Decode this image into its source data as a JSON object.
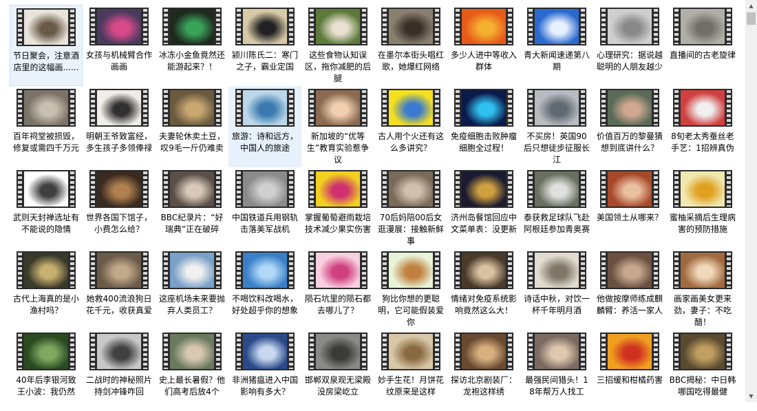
{
  "items": [
    {
      "caption": "节日聚会，注意酒店里的这幅画......",
      "icon": "video-thumbnail-icon",
      "bg": "#e8e4dc",
      "fg": "#6a5a48"
    },
    {
      "caption": "女孩与机械臂合作画画",
      "icon": "video-thumbnail-icon",
      "bg": "#4a3a5e",
      "fg": "#d94a8a"
    },
    {
      "caption": "冰冻小金鱼竟然还能游起来？！",
      "icon": "video-thumbnail-icon",
      "bg": "#1e2a1e",
      "fg": "#3aa35a"
    },
    {
      "caption": "颍川陈氏二：寒门之子，霸业定国",
      "icon": "video-thumbnail-icon",
      "bg": "#d8c9a8",
      "fg": "#222222"
    },
    {
      "caption": "这些食物认知误区，拖你减肥的后腿",
      "icon": "video-thumbnail-icon",
      "bg": "#5c7a3a",
      "fg": "#e8e0d0"
    },
    {
      "caption": "在墨尔本街头唱红歌，她爆红网络",
      "icon": "video-thumbnail-icon",
      "bg": "#8a8070",
      "fg": "#3a3028"
    },
    {
      "caption": "多少人进中等收入群体",
      "icon": "video-thumbnail-icon",
      "bg": "#e85a1a",
      "fg": "#f4b030"
    },
    {
      "caption": "青大新闻速递第八期",
      "icon": "video-thumbnail-icon",
      "bg": "#2a6ad0",
      "fg": "#e8f0ff"
    },
    {
      "caption": "心理研究：据说越聪明的人朋友越少",
      "icon": "video-thumbnail-icon",
      "bg": "#cfcfcf",
      "fg": "#888888"
    },
    {
      "caption": "直播间的古老旋律",
      "icon": "video-thumbnail-icon",
      "bg": "#b0b0a8",
      "fg": "#707068"
    },
    {
      "caption": "百年祠堂被损毁，修复或需四千万元",
      "icon": "video-thumbnail-icon",
      "bg": "#7a7468",
      "fg": "#c8c0b0"
    },
    {
      "caption": "明朝王爷致富经，多生孩子多领俸禄",
      "icon": "video-thumbnail-icon",
      "bg": "#f0eee8",
      "fg": "#303030"
    },
    {
      "caption": "夫妻轮休卖土豆，叹9毛一斤仍难卖",
      "icon": "video-thumbnail-icon",
      "bg": "#6a5a40",
      "fg": "#c8a870"
    },
    {
      "caption": "旅游：诗和远方，中国人的旅途",
      "icon": "video-thumbnail-icon",
      "bg": "#bcd8e8",
      "fg": "#3a7ab0"
    },
    {
      "caption": "新加坡的“优等生”教育实验惹争议",
      "icon": "video-thumbnail-icon",
      "bg": "#8a6a50",
      "fg": "#f0d0b0"
    },
    {
      "caption": "古人用个火还有这么多讲究？",
      "icon": "video-thumbnail-icon",
      "bg": "#f4e020",
      "fg": "#3a7ad0"
    },
    {
      "caption": "免疫细胞击败肿瘤细胞全过程！",
      "icon": "video-thumbnail-icon",
      "bg": "#0a1a4a",
      "fg": "#30c0f0"
    },
    {
      "caption": "不买房！英国90后只想徒步征服长江",
      "icon": "video-thumbnail-icon",
      "bg": "#b8bcc0",
      "fg": "#606870"
    },
    {
      "caption": "价值百万的黎曼猜想到底讲什么？",
      "icon": "video-thumbnail-icon",
      "bg": "#5a6a58",
      "fg": "#d0a890"
    },
    {
      "caption": "8旬老太秀蚕丝老手艺：1招辨真伪",
      "icon": "video-thumbnail-icon",
      "bg": "#d04040",
      "fg": "#f0f0f0"
    },
    {
      "caption": "武则天封禅选址有不能说的隐情",
      "icon": "video-thumbnail-icon",
      "bg": "#ffffff",
      "fg": "#404040"
    },
    {
      "caption": "世界各国下馆子，小费怎么给？",
      "icon": "video-thumbnail-icon",
      "bg": "#3a2a20",
      "fg": "#b08050"
    },
    {
      "caption": "BBC纪录片：“好瑞典”正在破碎",
      "icon": "video-thumbnail-icon",
      "bg": "#5a5048",
      "fg": "#d8c8b8"
    },
    {
      "caption": "中国铁道兵用钢轨击落美军战机",
      "icon": "video-thumbnail-icon",
      "bg": "#8a8a8a",
      "fg": "#d0d0d0"
    },
    {
      "caption": "掌握葡萄避雨栽培技术减少果实伤害",
      "icon": "video-thumbnail-icon",
      "bg": "#f0d020",
      "fg": "#d03070"
    },
    {
      "caption": "70后妈陪00后女逛漫展：接触新鲜事",
      "icon": "video-thumbnail-icon",
      "bg": "#7a6a5a",
      "fg": "#d0c0b0"
    },
    {
      "caption": "济州岛餐馆回应中文菜单表：没更新",
      "icon": "video-thumbnail-icon",
      "bg": "#1a1a30",
      "fg": "#d0a040"
    },
    {
      "caption": "泰获救足球队飞赴阿根廷参加青奥赛",
      "icon": "video-thumbnail-icon",
      "bg": "#6a7060",
      "fg": "#e0e0e0"
    },
    {
      "caption": "美国领土从哪来？",
      "icon": "video-thumbnail-icon",
      "bg": "#a8482a",
      "fg": "#e8c0a0"
    },
    {
      "caption": "蜜柚采摘后生理病害的预防措施",
      "icon": "video-thumbnail-icon",
      "bg": "#f0e8b0",
      "fg": "#e0a020"
    },
    {
      "caption": "古代上海真的是小渔村吗？",
      "icon": "video-thumbnail-icon",
      "bg": "#3a3a2a",
      "fg": "#c8b070"
    },
    {
      "caption": "她救400流浪狗日花千元，收获真爱",
      "icon": "video-thumbnail-icon",
      "bg": "#6a5a48",
      "fg": "#c0a888"
    },
    {
      "caption": "这座机场未来要抛弃人类员工？",
      "icon": "video-thumbnail-icon",
      "bg": "#7aa0c8",
      "fg": "#f0f0f0"
    },
    {
      "caption": "不喝饮料改喝水，好处超乎你的想象",
      "icon": "video-thumbnail-icon",
      "bg": "#3a80c8",
      "fg": "#b0d8f8"
    },
    {
      "caption": "陨石坑里的陨石都去哪儿了？",
      "icon": "video-thumbnail-icon",
      "bg": "#f8d0e0",
      "fg": "#d04080"
    },
    {
      "caption": "狗比你想的更聪明，它可能假装爱你",
      "icon": "video-thumbnail-icon",
      "bg": "#e8f4d8",
      "fg": "#c08040"
    },
    {
      "caption": "情绪对免疫系统影响竟然这么大！",
      "icon": "video-thumbnail-icon",
      "bg": "#4a3a2a",
      "fg": "#d8c0a0"
    },
    {
      "caption": "诗话中秋，对饮一杯千年明月酒",
      "icon": "video-thumbnail-icon",
      "bg": "#e0dcd0",
      "fg": "#807868"
    },
    {
      "caption": "他做按摩师练成麒麟臂：养活一家人",
      "icon": "video-thumbnail-icon",
      "bg": "#6a5040",
      "fg": "#c8a890"
    },
    {
      "caption": "画家画美女更来劲，妻子：不吃醋！",
      "icon": "video-thumbnail-icon",
      "bg": "#a06a40",
      "fg": "#f0d8b8"
    },
    {
      "caption": "40年后李银河致王小波：我仍然",
      "icon": "video-thumbnail-icon",
      "bg": "#2a4a20",
      "fg": "#80a860"
    },
    {
      "caption": "二战时的神秘照片 持剑冲锋咋回",
      "icon": "video-thumbnail-icon",
      "bg": "#c8c8c8",
      "fg": "#404040"
    },
    {
      "caption": "史上最长暑假？他们高考后放4个",
      "icon": "video-thumbnail-icon",
      "bg": "#6a7a60",
      "fg": "#d8c8b0"
    },
    {
      "caption": "非洲猪瘟进入中国影响有多大？",
      "icon": "video-thumbnail-icon",
      "bg": "#2a4a8a",
      "fg": "#c8d8f0"
    },
    {
      "caption": "邯郸双泉观无梁殿没房梁屹立",
      "icon": "video-thumbnail-icon",
      "bg": "#8a8a88",
      "fg": "#3a3a38"
    },
    {
      "caption": "妙手生花！月饼花纹原来是这样",
      "icon": "video-thumbnail-icon",
      "bg": "#d8c8a8",
      "fg": "#8a6a40"
    },
    {
      "caption": "探访北京剧装厂：龙袍这样绣",
      "icon": "video-thumbnail-icon",
      "bg": "#6a4a30",
      "fg": "#d8b080"
    },
    {
      "caption": "最强民间猎头！18年帮万人找工",
      "icon": "video-thumbnail-icon",
      "bg": "#7a6a60",
      "fg": "#e0c8b0"
    },
    {
      "caption": "三招缓和柑橘药害",
      "icon": "video-thumbnail-icon",
      "bg": "#f0a020",
      "fg": "#d03020"
    },
    {
      "caption": "BBC揭秘：中日韩哪国吃得最健",
      "icon": "video-thumbnail-icon",
      "bg": "#5a4a30",
      "fg": "#c0a060"
    }
  ]
}
